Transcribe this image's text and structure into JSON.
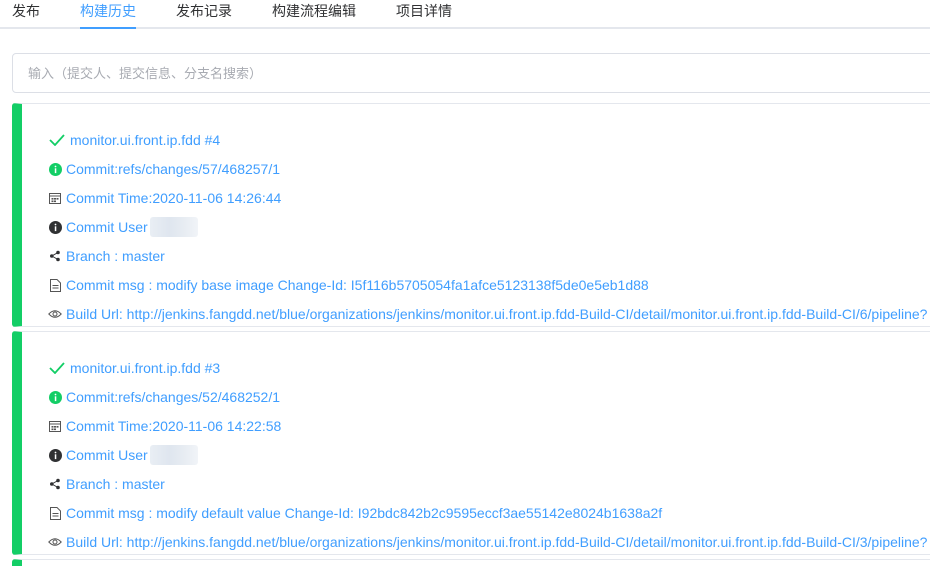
{
  "tabs": [
    {
      "label": "发布"
    },
    {
      "label": "构建历史"
    },
    {
      "label": "发布记录"
    },
    {
      "label": "构建流程编辑"
    },
    {
      "label": "项目详情"
    }
  ],
  "active_tab": "构建历史",
  "search": {
    "placeholder": "输入（提交人、提交信息、分支名搜索）",
    "value": ""
  },
  "builds": [
    {
      "title": "monitor.ui.front.ip.fdd #4",
      "commit": "Commit:refs/changes/57/468257/1",
      "commit_time": "Commit Time:2020-11-06 14:26:44",
      "commit_user": "Commit User",
      "branch": "Branch : master",
      "commit_msg": "Commit msg : modify base image Change-Id: I5f116b5705054fa1afce5123138f5de0e5eb1d88",
      "build_url": "Build Url: http://jenkins.fangdd.net/blue/organizations/jenkins/monitor.ui.front.ip.fdd-Build-CI/detail/monitor.ui.front.ip.fdd-Build-CI/6/pipeline?"
    },
    {
      "title": "monitor.ui.front.ip.fdd #3",
      "commit": "Commit:refs/changes/52/468252/1",
      "commit_time": "Commit Time:2020-11-06 14:22:58",
      "commit_user": "Commit User",
      "branch": "Branch : master",
      "commit_msg": "Commit msg : modify default value Change-Id: I92bdc842b2c9595eccf3ae55142e8024b1638a2f",
      "build_url": "Build Url: http://jenkins.fangdd.net/blue/organizations/jenkins/monitor.ui.front.ip.fdd-Build-CI/detail/monitor.ui.front.ip.fdd-Build-CI/3/pipeline?"
    }
  ],
  "colors": {
    "accent": "#409eff",
    "success": "#13ce66",
    "border": "#e4e7ed",
    "text": "#303133"
  },
  "icons": [
    "check-icon",
    "info-circle-green-icon",
    "calendar-icon",
    "info-circle-dark-icon",
    "share-icon",
    "document-icon",
    "eye-icon"
  ]
}
